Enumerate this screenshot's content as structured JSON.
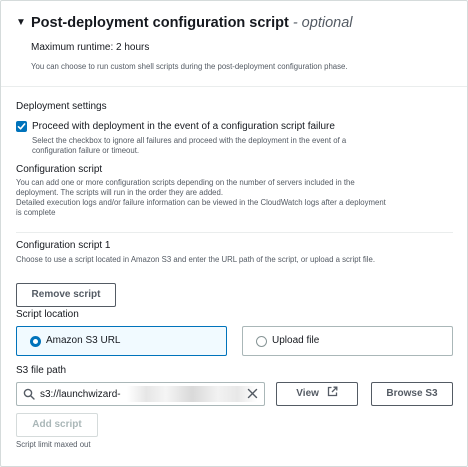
{
  "header": {
    "title": "Post-deployment configuration script",
    "optional": "- optional",
    "runtime": "Maximum runtime: 2 hours",
    "description": "You can choose to run custom shell scripts during the post-deployment configuration phase."
  },
  "deployment_settings": {
    "label": "Deployment settings",
    "checkbox_checked": true,
    "checkbox_label": "Proceed with deployment in the event of a configuration script failure",
    "checkbox_desc_1": "Select the checkbox to ignore all failures and proceed with the deployment in the event of a",
    "checkbox_desc_2": "configuration failure or timeout."
  },
  "configuration_script": {
    "label": "Configuration script",
    "desc_1": "You can add one or more configuration scripts depending on the number of servers included in the",
    "desc_2": "deployment. The scripts will run in the order they are added.",
    "desc_3": "Detailed execution logs and/or failure information can be viewed in the CloudWatch logs after a deployment",
    "desc_4": "is complete"
  },
  "script_1": {
    "title": "Configuration script 1",
    "desc": "Choose to use a script located in Amazon S3 and enter the URL path of the script, or upload a script file.",
    "remove_label": "Remove script",
    "location_label": "Script location",
    "options": [
      {
        "label": "Amazon S3 URL",
        "selected": true
      },
      {
        "label": "Upload file",
        "selected": false
      }
    ],
    "path_label": "S3 file path",
    "path_value": "s3://launchwizard-",
    "view_label": "View",
    "browse_label": "Browse S3"
  },
  "footer": {
    "add_label": "Add script",
    "limit_text": "Script limit maxed out"
  },
  "colors": {
    "accent": "#0073bb",
    "text": "#16191f",
    "muted": "#545b64",
    "border": "#aab7b8"
  }
}
